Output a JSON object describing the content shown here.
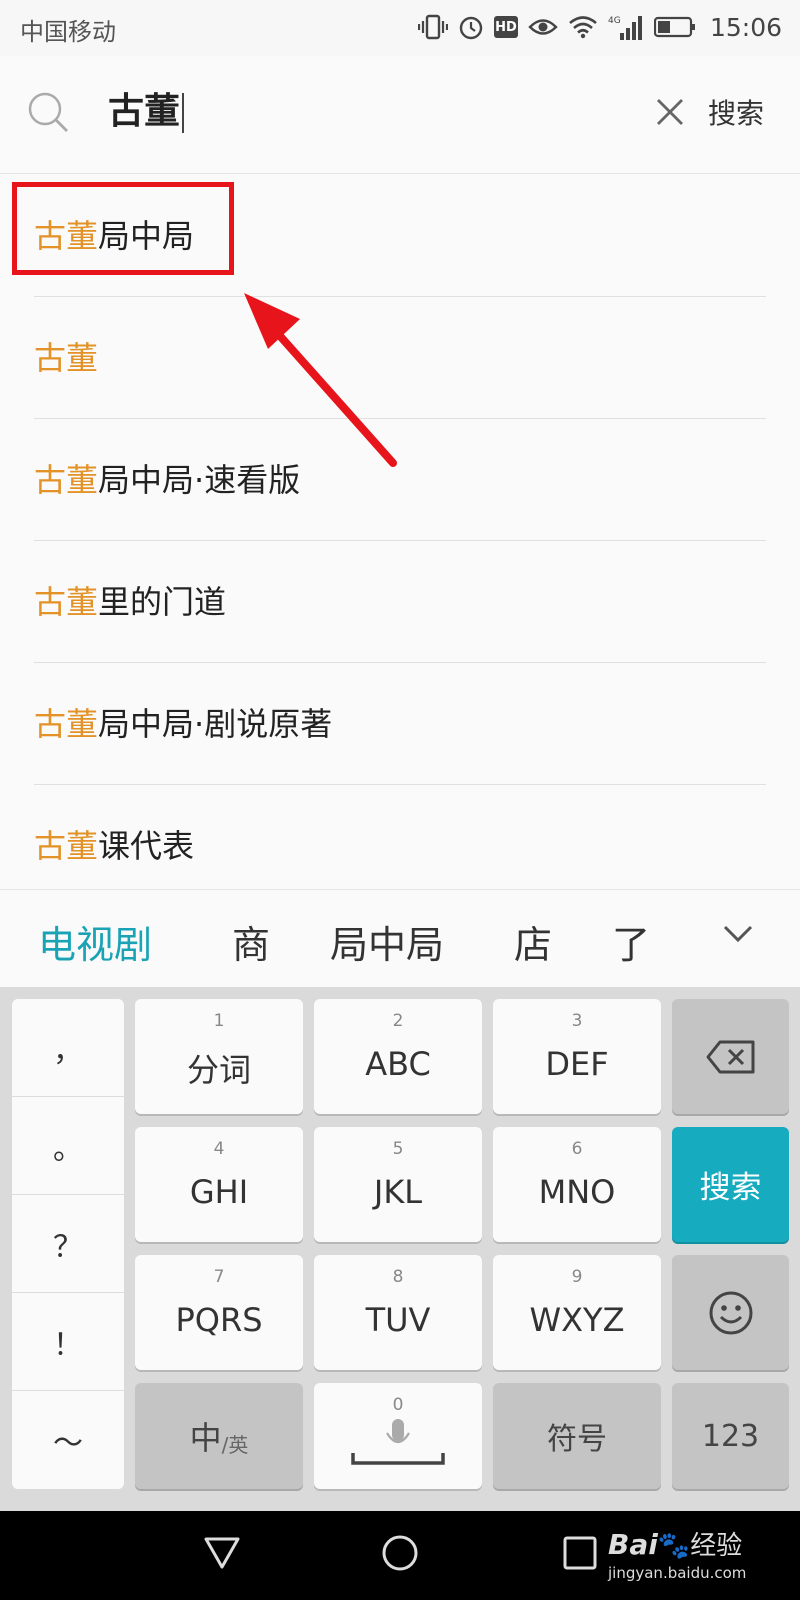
{
  "status_bar": {
    "carrier": "中国移动",
    "network": "4G",
    "time": "15:06",
    "icons": [
      "vibrate-icon",
      "alarm-icon",
      "hd-icon",
      "eye-icon",
      "wifi-icon",
      "signal-icon",
      "battery-icon"
    ],
    "hd_label": "HD"
  },
  "search": {
    "query": "古董",
    "button_label": "搜索"
  },
  "suggestions": [
    {
      "highlight": "古董",
      "rest": "局中局"
    },
    {
      "highlight": "古董",
      "rest": ""
    },
    {
      "highlight": "古董",
      "rest": "局中局·速看版"
    },
    {
      "highlight": "古董",
      "rest": "里的门道"
    },
    {
      "highlight": "古董",
      "rest": "局中局·剧说原著"
    },
    {
      "highlight": "古董",
      "rest": "课代表"
    }
  ],
  "candidates": [
    "电视剧",
    "商",
    "局中局",
    "店",
    "了"
  ],
  "keyboard": {
    "punctuation": [
      "，",
      "。",
      "？",
      "！",
      "～"
    ],
    "keys": [
      {
        "num": "1",
        "label": "分词"
      },
      {
        "num": "2",
        "label": "ABC"
      },
      {
        "num": "3",
        "label": "DEF"
      },
      {
        "num": "4",
        "label": "GHI"
      },
      {
        "num": "5",
        "label": "JKL"
      },
      {
        "num": "6",
        "label": "MNO"
      },
      {
        "num": "7",
        "label": "PQRS"
      },
      {
        "num": "8",
        "label": "TUV"
      },
      {
        "num": "9",
        "label": "WXYZ"
      }
    ],
    "search_key": "搜索",
    "lang_key_main": "中",
    "lang_key_sub": "/英",
    "space_num": "0",
    "symbol_key": "符号",
    "number_key": "123"
  },
  "watermark": {
    "brand": "Bai",
    "brand_cn": "经验",
    "url": "jingyan.baidu.com"
  },
  "colors": {
    "highlight_text": "#e39227",
    "accent": "#17abc0",
    "annotation_red": "#e8141b"
  }
}
